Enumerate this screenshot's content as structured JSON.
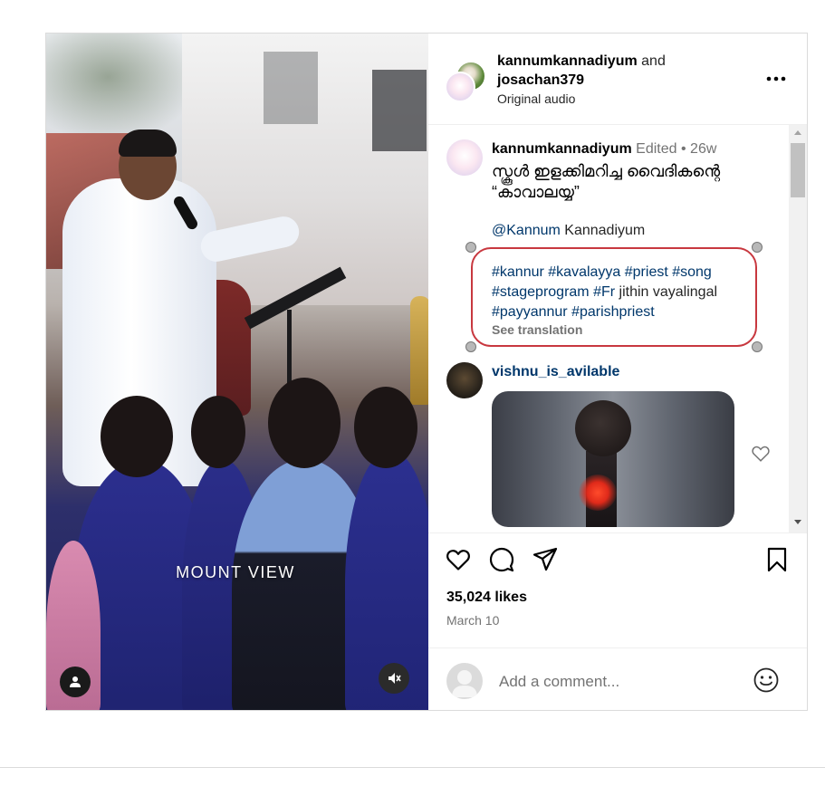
{
  "media": {
    "caption": "MOUNT VIEW",
    "user_icon": "user-icon",
    "mute_icon": "muted-speaker-icon"
  },
  "header": {
    "user1": "kannumkannadiyum",
    "and_text": " and",
    "user2": "josachan379",
    "audio": "Original audio",
    "more_icon": "more-horizontal-icon",
    "more_glyph": "•••"
  },
  "caption": {
    "username": "kannumkannadiyum",
    "edited": "Edited",
    "separator": "•",
    "age": "26w",
    "text": "സ്കൂൾ ഇളക്കിമറിച്ച വൈദികന്റെ “കാവാലയ്യ”",
    "mention": "@Kannum",
    "mention_rest": " Kannadiyum",
    "hashtags_line1": "#kannur #kavalayya #priest #song",
    "hashtags_line2_tag": "#stageprogram #Fr",
    "hashtags_line2_rest": " jithin vayalingal",
    "hashtags_line3": "#payyannur #parishpriest",
    "see_translation": "See translation"
  },
  "reply": {
    "username": "vishnu_is_avilable",
    "like_icon": "heart-outline-icon"
  },
  "actions": {
    "like_icon": "heart-icon",
    "comment_icon": "comment-icon",
    "share_icon": "share-icon",
    "save_icon": "bookmark-icon",
    "likes": "35,024 likes",
    "date": "March 10"
  },
  "comment_box": {
    "placeholder": "Add a comment...",
    "emoji_icon": "emoji-icon"
  }
}
